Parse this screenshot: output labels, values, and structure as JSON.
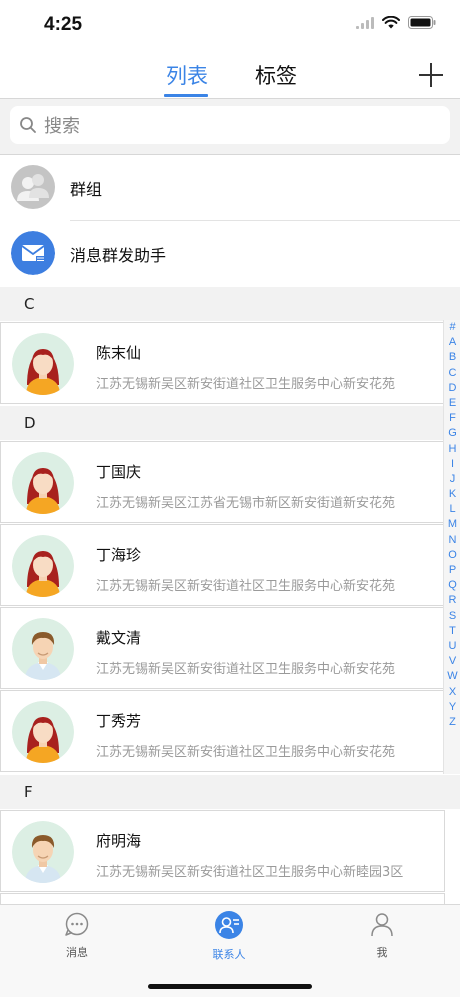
{
  "status_bar": {
    "time": "4:25"
  },
  "nav": {
    "tab_list": "列表",
    "tab_tags": "标签"
  },
  "search": {
    "placeholder": "搜索"
  },
  "special_rows": [
    {
      "label": "群组",
      "icon": "group-avatar-icon"
    },
    {
      "label": "消息群发助手",
      "icon": "mail-broadcast-icon"
    }
  ],
  "sections": [
    {
      "letter": "C",
      "contacts": [
        {
          "name": "陈末仙",
          "address": "江苏无锡新吴区新安街道社区卫生服务中心新安花苑",
          "avatar": "female"
        }
      ]
    },
    {
      "letter": "D",
      "contacts": [
        {
          "name": "丁国庆",
          "address": "江苏无锡新吴区江苏省无锡市新区新安街道新安花苑",
          "avatar": "female"
        },
        {
          "name": "丁海珍",
          "address": "江苏无锡新吴区新安街道社区卫生服务中心新安花苑",
          "avatar": "female"
        },
        {
          "name": "戴文清",
          "address": "江苏无锡新吴区新安街道社区卫生服务中心新安花苑",
          "avatar": "male"
        },
        {
          "name": "丁秀芳",
          "address": "江苏无锡新吴区新安街道社区卫生服务中心新安花苑",
          "avatar": "female"
        }
      ]
    },
    {
      "letter": "F",
      "contacts": [
        {
          "name": "府明海",
          "address": "江苏无锡新吴区新安街道社区卫生服务中心新睦园3区",
          "avatar": "male"
        }
      ]
    }
  ],
  "index_letters": [
    "#",
    "A",
    "B",
    "C",
    "D",
    "E",
    "F",
    "G",
    "H",
    "I",
    "J",
    "K",
    "L",
    "M",
    "N",
    "O",
    "P",
    "Q",
    "R",
    "S",
    "T",
    "U",
    "V",
    "W",
    "X",
    "Y",
    "Z"
  ],
  "tab_bar": {
    "messages": "消息",
    "contacts": "联系人",
    "me": "我"
  },
  "colors": {
    "accent": "#3b84e6",
    "section_bg": "#f2f2f2"
  }
}
